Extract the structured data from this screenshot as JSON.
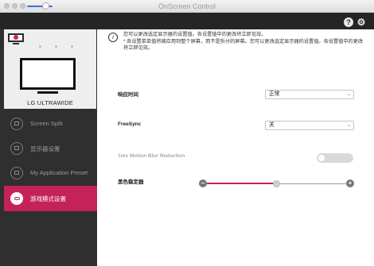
{
  "window": {
    "title": "OnScreen Control"
  },
  "header": {
    "help_label": "?",
    "gear_label": "⚙"
  },
  "sidebar": {
    "model_name": "LG ULTRAWIDE",
    "items": [
      {
        "label": "Screen Split",
        "icon": "screen-split-icon",
        "active": false
      },
      {
        "label": "显示器设置",
        "icon": "monitor-settings-icon",
        "active": false
      },
      {
        "label": "My Application Preset",
        "icon": "app-preset-icon",
        "active": false
      },
      {
        "label": "游戏模式设置",
        "icon": "game-mode-icon",
        "active": true
      }
    ]
  },
  "info": {
    "line1": "您可以更改选定显示器的设置值。各设置值中的更改将立即见效。",
    "line2": "* 各设置菜单值将被应用到整个屏幕，而不是拆分的屏幕。您可以更改选定显示器的设置值。各设置值中的更改将立即见效。"
  },
  "settings": {
    "response_time": {
      "label": "响应时间",
      "value": "正常"
    },
    "freesync": {
      "label": "FreeSync",
      "value": "关"
    },
    "motion_blur": {
      "label": "1ms Motion Blur Reduction",
      "enabled": false,
      "state": "off"
    },
    "black_stabilizer": {
      "label": "黑色稳定器",
      "minus": "−",
      "plus": "+",
      "value_fraction": 0.5
    }
  },
  "colors": {
    "accent": "#c5225a",
    "sidebar_bg": "#2f2f2f",
    "header_bg": "#252525"
  }
}
